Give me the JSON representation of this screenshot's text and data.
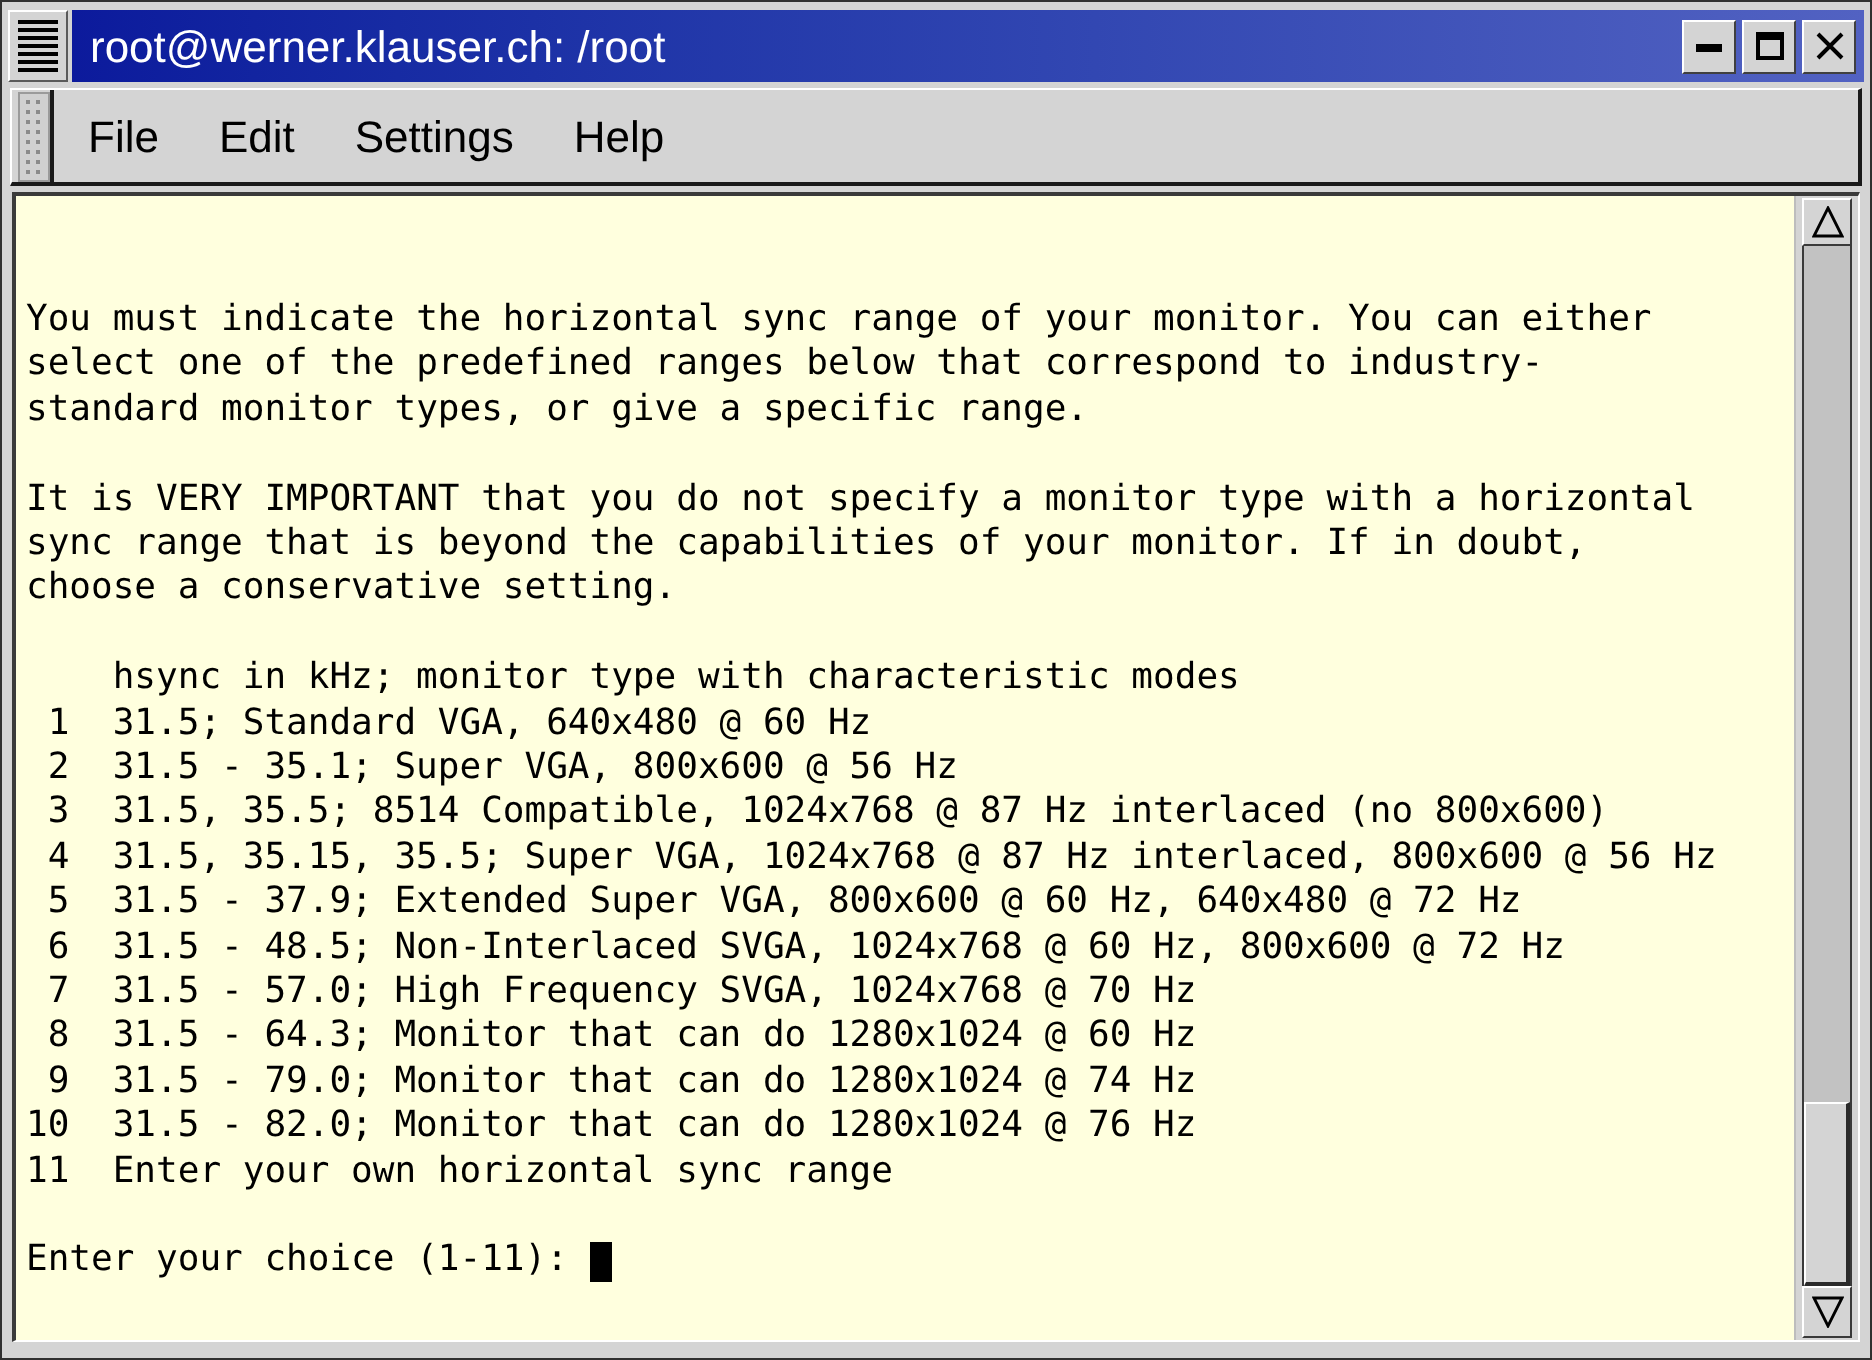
{
  "window": {
    "title": "root@werner.klauser.ch: /root"
  },
  "menu_bar": {
    "items": [
      "File",
      "Edit",
      "Settings",
      "Help"
    ]
  },
  "terminal": {
    "paragraphs": [
      "You must indicate the horizontal sync range of your monitor. You can either\nselect one of the predefined ranges below that correspond to industry-\nstandard monitor types, or give a specific range.",
      "It is VERY IMPORTANT that you do not specify a monitor type with a horizontal\nsync range that is beyond the capabilities of your monitor. If in doubt,\nchoose a conservative setting."
    ],
    "list_header": "hsync in kHz; monitor type with characteristic modes",
    "options": [
      {
        "number": "1",
        "text": "31.5; Standard VGA, 640x480 @ 60 Hz"
      },
      {
        "number": "2",
        "text": "31.5 - 35.1; Super VGA, 800x600 @ 56 Hz"
      },
      {
        "number": "3",
        "text": "31.5, 35.5; 8514 Compatible, 1024x768 @ 87 Hz interlaced (no 800x600)"
      },
      {
        "number": "4",
        "text": "31.5, 35.15, 35.5; Super VGA, 1024x768 @ 87 Hz interlaced, 800x600 @ 56 Hz"
      },
      {
        "number": "5",
        "text": "31.5 - 37.9; Extended Super VGA, 800x600 @ 60 Hz, 640x480 @ 72 Hz"
      },
      {
        "number": "6",
        "text": "31.5 - 48.5; Non-Interlaced SVGA, 1024x768 @ 60 Hz, 800x600 @ 72 Hz"
      },
      {
        "number": "7",
        "text": "31.5 - 57.0; High Frequency SVGA, 1024x768 @ 70 Hz"
      },
      {
        "number": "8",
        "text": "31.5 - 64.3; Monitor that can do 1280x1024 @ 60 Hz"
      },
      {
        "number": "9",
        "text": "31.5 - 79.0; Monitor that can do 1280x1024 @ 74 Hz"
      },
      {
        "number": "10",
        "text": "31.5 - 82.0; Monitor that can do 1280x1024 @ 76 Hz"
      },
      {
        "number": "11",
        "text": "Enter your own horizontal sync range"
      }
    ],
    "prompt": "Enter your choice (1-11):",
    "cursor": true
  }
}
